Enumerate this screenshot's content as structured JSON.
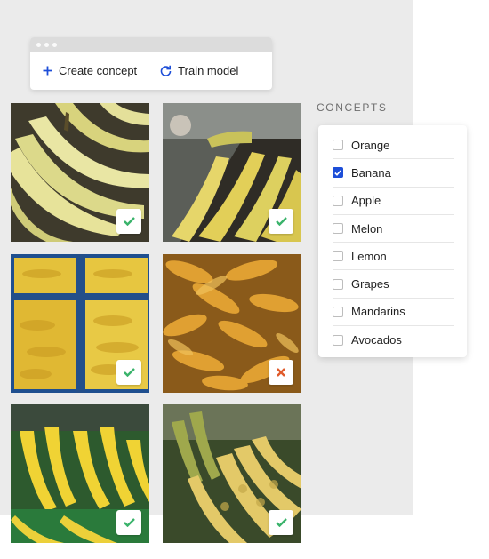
{
  "toolbar": {
    "create_label": "Create concept",
    "train_label": "Train model"
  },
  "concepts": {
    "heading": "CONCEPTS",
    "items": [
      {
        "label": "Orange",
        "checked": false
      },
      {
        "label": "Banana",
        "checked": true
      },
      {
        "label": "Apple",
        "checked": false
      },
      {
        "label": "Melon",
        "checked": false
      },
      {
        "label": "Lemon",
        "checked": false
      },
      {
        "label": "Grapes",
        "checked": false
      },
      {
        "label": "Mandarins",
        "checked": false
      },
      {
        "label": "Avocados",
        "checked": false
      }
    ]
  },
  "images": [
    {
      "subject": "bananas",
      "status": "check"
    },
    {
      "subject": "bananas",
      "status": "check"
    },
    {
      "subject": "bananas",
      "status": "check"
    },
    {
      "subject": "corn",
      "status": "cross"
    },
    {
      "subject": "bananas",
      "status": "check"
    },
    {
      "subject": "bananas",
      "status": "check"
    }
  ],
  "colors": {
    "accent": "#1d4ed8",
    "check": "#3ab36b",
    "cross": "#e05a2b"
  }
}
